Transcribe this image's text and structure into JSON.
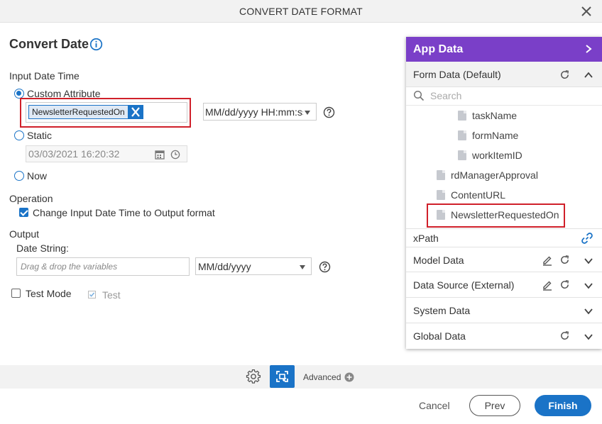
{
  "dialog": {
    "title": "CONVERT DATE FORMAT"
  },
  "convert": {
    "heading": "Convert Date"
  },
  "input": {
    "label": "Input Date Time",
    "custom_attribute_label": "Custom Attribute",
    "custom_attribute_token": "NewsletterRequestedOn",
    "format_value": "MM/dd/yyyy HH:mm:ss",
    "static_label": "Static",
    "static_value": "03/03/2021 16:20:32",
    "now_label": "Now"
  },
  "operation": {
    "label": "Operation",
    "change_label": "Change Input Date Time to Output format"
  },
  "output": {
    "label": "Output",
    "date_string_label": "Date String:",
    "date_string_placeholder": "Drag & drop the variables",
    "format_value": "MM/dd/yyyy"
  },
  "test": {
    "mode_label": "Test Mode",
    "test_label": "Test"
  },
  "app_data": {
    "title": "App Data",
    "form_data": "Form Data (Default)",
    "search_placeholder": "Search",
    "tree": [
      "taskName",
      "formName",
      "workItemID",
      "rdManagerApproval",
      "ContentURL",
      "NewsletterRequestedOn"
    ],
    "xpath": "xPath",
    "sections": [
      "Model Data",
      "Data Source (External)",
      "System Data",
      "Global Data"
    ]
  },
  "toolbar": {
    "advanced_label": "Advanced"
  },
  "footer": {
    "cancel": "Cancel",
    "prev": "Prev",
    "finish": "Finish"
  },
  "colors": {
    "accent": "#1a73c7",
    "panel_header": "#7a3fc8",
    "highlight": "#d0202a"
  }
}
